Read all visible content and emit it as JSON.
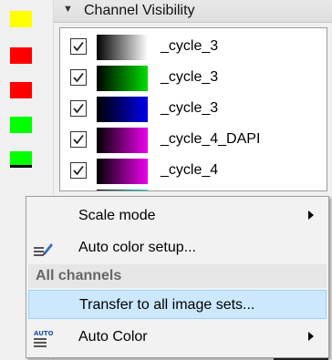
{
  "channel_panel": {
    "title": "Channel Visibility",
    "channels": [
      {
        "name": "_cycle_3",
        "checked": true,
        "ramp_color": "#ffffff"
      },
      {
        "name": "_cycle_3",
        "checked": true,
        "ramp_color": "#00dd00"
      },
      {
        "name": "_cycle_3",
        "checked": true,
        "ramp_color": "#0000ee"
      },
      {
        "name": "_cycle_4_DAPI",
        "checked": true,
        "ramp_color": "#ee00ee"
      },
      {
        "name": "_cycle_4",
        "checked": true,
        "ramp_color": "#ee00ee"
      }
    ]
  },
  "swatches": [
    "#ffff00",
    "#ff0000",
    "#ff0000",
    "#00ff00",
    "#00ff00"
  ],
  "context_menu": {
    "scale_mode": "Scale mode",
    "auto_color_setup": "Auto color setup...",
    "section_all_channels": "All channels",
    "transfer": "Transfer to all image sets...",
    "auto_color": "Auto Color",
    "auto_icon_text": "AUTO"
  }
}
